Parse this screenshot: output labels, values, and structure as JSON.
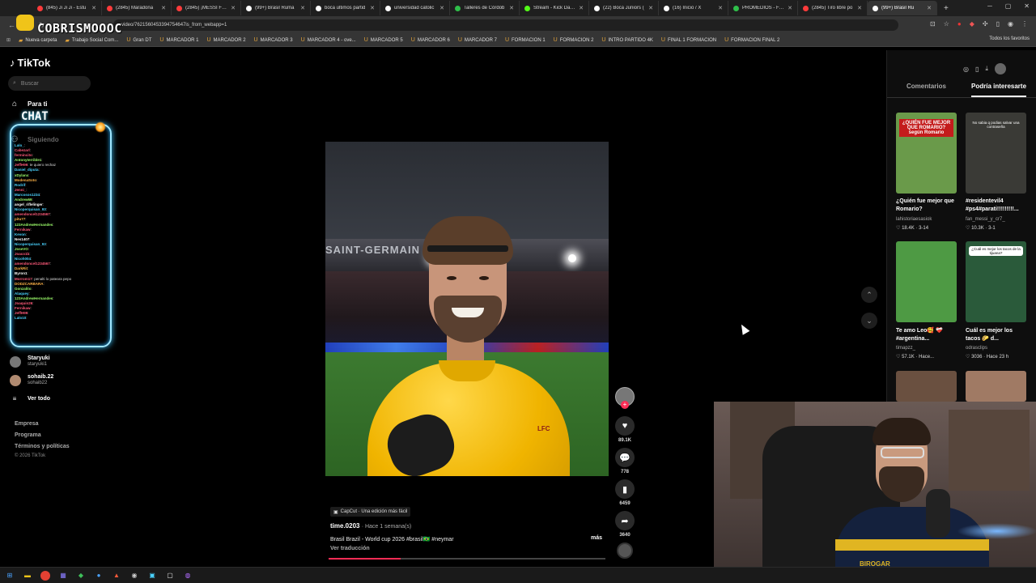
{
  "browser": {
    "tabs": [
      {
        "label": "(845) Ji Ji Ji - Estu",
        "color": "#ff3b3b"
      },
      {
        "label": "(2845) Maradona",
        "color": "#ff3b3b"
      },
      {
        "label": "(2845) ¡MESSI FICI",
        "color": "#ff3b3b"
      },
      {
        "label": "(99+) Brasil Ruma",
        "color": "#ffffff"
      },
      {
        "label": "boca ultimos partid",
        "color": "#ffffff"
      },
      {
        "label": "universidad catolic",
        "color": "#ffffff"
      },
      {
        "label": "Talleres de Córdob",
        "color": "#2fbf4a"
      },
      {
        "label": "Stream - Kick Dashb",
        "color": "#53fc18"
      },
      {
        "label": "(22) Boca Juniors (",
        "color": "#ffffff"
      },
      {
        "label": "(16) Inicio / X",
        "color": "#ffffff"
      },
      {
        "label": "PROMEDIOS - Fútb",
        "color": "#2fbf4a"
      },
      {
        "label": "(2845) Tiro libre po",
        "color": "#ff3b3b"
      },
      {
        "label": "(99+) Brasil Ru",
        "color": "#ffffff"
      }
    ],
    "new_tab_icon": "plus-icon",
    "url": "video/7621560453394754647is_from_webapp=1",
    "bookmarks": [
      "Nueva carpeta",
      "Trabajo Social Com...",
      "Gran DT",
      "MARCADOR 1",
      "MARCADOR 2",
      "MARCADOR 3",
      "MARCADOR 4 - ove...",
      "MARCADOR 5",
      "MARCADOR 6",
      "MARCADOR 7",
      "FORMACION 1",
      "FORMACION 2",
      "INTRO PARTIDO 4K",
      "FINAL 1 FORMACION",
      "FORMACION FINAL 2"
    ],
    "bookmarks_all": "Todos los favoritos"
  },
  "stream_overlay": {
    "logo_text": "COBRISMOOOC",
    "chat_title": "CHAT",
    "chat_lines": [
      {
        "user": "Lalo_",
        "msg": "",
        "color": "#4ad3ff"
      },
      {
        "user": "Cabezarl",
        "msg": "",
        "color": "#ff5a7a"
      },
      {
        "user": "fermincito",
        "msg": "",
        "color": "#ff5a7a"
      },
      {
        "user": "Antonyterrible1",
        "msg": "",
        "color": "#9dff6b"
      },
      {
        "user": "JeffH99",
        "msg": "te quiero rechaz",
        "color": "#ff5a7a"
      },
      {
        "user": "Daniel_diputa",
        "msg": "",
        "color": "#4ad3ff"
      },
      {
        "user": "xDylanx",
        "msg": "",
        "color": "#9dff6b"
      },
      {
        "user": "ModenaSoto",
        "msg": "",
        "color": "#ffb347"
      },
      {
        "user": "Rodrif",
        "msg": "",
        "color": "#4ad3ff"
      },
      {
        "user": "Jenni_",
        "msg": "",
        "color": "#ff5a7a"
      },
      {
        "user": "Marcosos1234",
        "msg": "",
        "color": "#4ad3ff"
      },
      {
        "user": "Andrew69",
        "msg": "",
        "color": "#9dff6b"
      },
      {
        "user": "angel_riflelinger",
        "msg": "",
        "color": "#ffffff"
      },
      {
        "user": "Nicoperquisan_93",
        "msg": "",
        "color": "#4ad3ff"
      },
      {
        "user": "amendoncel1234567",
        "msg": "",
        "color": "#ff5a7a"
      },
      {
        "user": "pitu77",
        "msg": "",
        "color": "#ffb347"
      },
      {
        "user": "123AndrewHernandes",
        "msg": "",
        "color": "#9dff6b"
      },
      {
        "user": "Fernikaw",
        "msg": "",
        "color": "#ff5a7a"
      },
      {
        "user": "Kevon",
        "msg": "",
        "color": "#4ad3ff"
      },
      {
        "user": "Nes1407",
        "msg": "",
        "color": "#ffffff"
      },
      {
        "user": "Nicoperquisan_93",
        "msg": "",
        "color": "#4ad3ff"
      },
      {
        "user": "JoseVO",
        "msg": "",
        "color": "#9dff6b"
      },
      {
        "user": "Joaco1b",
        "msg": "",
        "color": "#ff5a7a"
      },
      {
        "user": "Nicoh004",
        "msg": "",
        "color": "#4ad3ff"
      },
      {
        "user": "amendoncel1234567",
        "msg": "",
        "color": "#ff5a7a"
      },
      {
        "user": "DarkRit",
        "msg": "",
        "color": "#ffb347"
      },
      {
        "user": "Byron1",
        "msg": "",
        "color": "#ffffff"
      },
      {
        "user": "Morrom17",
        "msg": "penalti lo pateara pepo",
        "color": "#ff5a7a"
      },
      {
        "user": "DODZCARBARA",
        "msg": "",
        "color": "#ffb347"
      },
      {
        "user": "Gonzalito",
        "msg": "",
        "color": "#9dff6b"
      },
      {
        "user": "Alaquey",
        "msg": "",
        "color": "#4ad3ff"
      },
      {
        "user": "123AndrewHernandes",
        "msg": "",
        "color": "#9dff6b"
      },
      {
        "user": "Joaquin26",
        "msg": "",
        "color": "#ff5a7a"
      },
      {
        "user": "Fernikaw",
        "msg": "",
        "color": "#ff5a7a"
      },
      {
        "user": "JeffH99",
        "msg": "",
        "color": "#ff5a7a"
      },
      {
        "user": "Lalo10",
        "msg": "",
        "color": "#4ad3ff"
      }
    ]
  },
  "tiktok": {
    "brand": "TikTok",
    "search_placeholder": "Buscar",
    "nav": [
      {
        "label": "Para ti",
        "icon": "home-icon"
      },
      {
        "label": "Siguiendo",
        "icon": "following-icon"
      }
    ],
    "following_accounts": [
      {
        "name": "Staryuki",
        "handle": "staryuki1"
      },
      {
        "name": "sohaib.22",
        "handle": "sohaib22"
      }
    ],
    "see_all": "Ver todo",
    "footer_links": [
      "Empresa",
      "Programa",
      "Términos y políticas"
    ],
    "copyright": "© 2026 TikTok",
    "video": {
      "stand_text": "SAINT-GERMAIN",
      "crest_text": "LFC",
      "capcut_label": "CapCut · Una edición más fácil",
      "author": "time.0203",
      "date": "· Hace 1 semana(s)",
      "caption": "Brasil Brazil - World cup 2026 #brasil🇧🇷 #neymar",
      "more": "más",
      "translate": "Ver traducción",
      "progress": 0.26
    },
    "actions": [
      {
        "name": "like",
        "icon": "heart-icon",
        "count": "89.1K"
      },
      {
        "name": "comment",
        "icon": "comment-icon",
        "count": "778"
      },
      {
        "name": "save",
        "icon": "bookmark-icon",
        "count": "6459"
      },
      {
        "name": "share",
        "icon": "share-icon",
        "count": "3640"
      }
    ],
    "right_panel": {
      "tabs": [
        "Comentarios",
        "Podría interesarte"
      ],
      "cards": [
        {
          "title": "¿Quién fue mejor que Romario?",
          "user": "lahistoriaesasiok",
          "likes": "18.4K",
          "date": "3-14",
          "thumb_text": "¿QUIÉN FUE MEJOR QUE ROMARIO? según Romario",
          "bg": "#6a9a4a"
        },
        {
          "title": "#residentevil4 #ps4#parati!!!!!!!!!...",
          "user": "fan_messi_y_cr7_",
          "likes": "10.3K",
          "date": "3-1",
          "thumb_text": "No sabia q podias salvar una contraseña",
          "bg": "#3a3a36"
        },
        {
          "title": "Te amo Leo🥰 ❤️‍🩹 #argentina...",
          "user": "timapzz_",
          "likes": "57.1K",
          "date": "Hace...",
          "thumb_text": "",
          "bg": "#4e9a44"
        },
        {
          "title": "Cuál es mejor los tacos 🌮 d...",
          "user": "odrasclips",
          "likes": "3036",
          "date": "Hace 23 h",
          "thumb_text": "¿Cuál es mejor los tacos de la tijuana?",
          "bg": "#2a5a3a"
        }
      ]
    }
  },
  "webcam": {
    "sponsor_text": "BIROGAR"
  }
}
